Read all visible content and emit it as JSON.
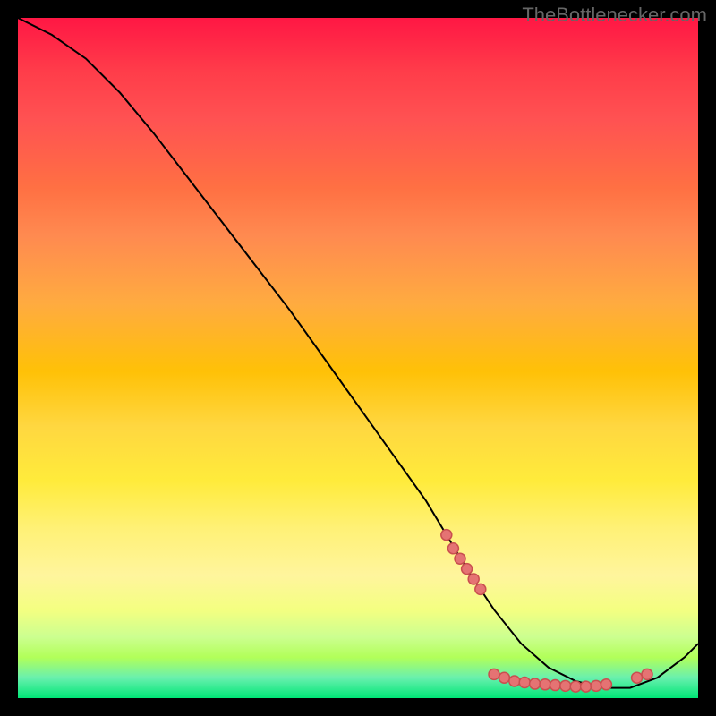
{
  "watermark": "TheBottlenecker.com",
  "chart_data": {
    "type": "line",
    "title": "",
    "xlabel": "",
    "ylabel": "",
    "xlim": [
      0,
      100
    ],
    "ylim": [
      0,
      100
    ],
    "series": [
      {
        "name": "curve",
        "x": [
          0,
          5,
          10,
          15,
          20,
          25,
          30,
          35,
          40,
          45,
          50,
          55,
          60,
          63,
          66,
          70,
          74,
          78,
          82,
          86,
          90,
          94,
          98,
          100
        ],
        "y": [
          100,
          97.5,
          94,
          89,
          83,
          76.5,
          70,
          63.5,
          57,
          50,
          43,
          36,
          29,
          24,
          19,
          13,
          8,
          4.5,
          2.5,
          1.5,
          1.5,
          3,
          6,
          8
        ]
      }
    ],
    "markers": [
      {
        "x": 63.0,
        "y": 24.0
      },
      {
        "x": 64.0,
        "y": 22.0
      },
      {
        "x": 65.0,
        "y": 20.5
      },
      {
        "x": 66.0,
        "y": 19.0
      },
      {
        "x": 67.0,
        "y": 17.5
      },
      {
        "x": 68.0,
        "y": 16.0
      },
      {
        "x": 70.0,
        "y": 3.5
      },
      {
        "x": 71.5,
        "y": 3.0
      },
      {
        "x": 73.0,
        "y": 2.5
      },
      {
        "x": 74.5,
        "y": 2.3
      },
      {
        "x": 76.0,
        "y": 2.1
      },
      {
        "x": 77.5,
        "y": 2.0
      },
      {
        "x": 79.0,
        "y": 1.9
      },
      {
        "x": 80.5,
        "y": 1.8
      },
      {
        "x": 82.0,
        "y": 1.7
      },
      {
        "x": 83.5,
        "y": 1.7
      },
      {
        "x": 85.0,
        "y": 1.8
      },
      {
        "x": 86.5,
        "y": 2.0
      },
      {
        "x": 91.0,
        "y": 3.0
      },
      {
        "x": 92.5,
        "y": 3.5
      }
    ],
    "colors": {
      "curve": "#000000",
      "marker_fill": "#e57373",
      "marker_stroke": "#c94f4f",
      "gradient_top": "#ff1744",
      "gradient_mid": "#ffeb3b",
      "gradient_bottom": "#00e676"
    }
  }
}
